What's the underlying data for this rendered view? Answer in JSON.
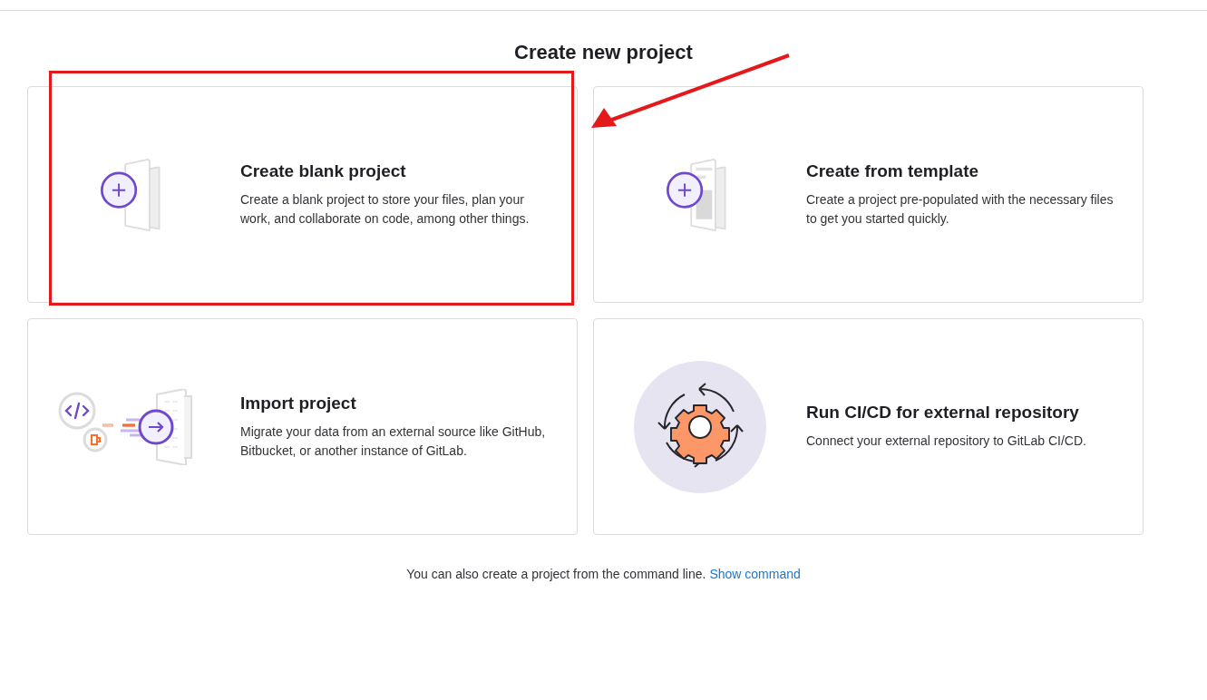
{
  "page_title": "Create new project",
  "cards": [
    {
      "kind": "blank",
      "title": "Create blank project",
      "description": "Create a blank project to store your files, plan your work, and collaborate on code, among other things.",
      "highlighted": true
    },
    {
      "kind": "template",
      "title": "Create from template",
      "description": "Create a project pre-populated with the necessary files to get you started quickly.",
      "highlighted": false
    },
    {
      "kind": "import",
      "title": "Import project",
      "description": "Migrate your data from an external source like GitHub, Bitbucket, or another instance of GitLab.",
      "highlighted": false
    },
    {
      "kind": "cicd",
      "title": "Run CI/CD for external repository",
      "description": "Connect your external repository to GitLab CI/CD.",
      "highlighted": false
    }
  ],
  "footer": {
    "text": "You can also create a project from the command line.",
    "link": "Show command"
  }
}
